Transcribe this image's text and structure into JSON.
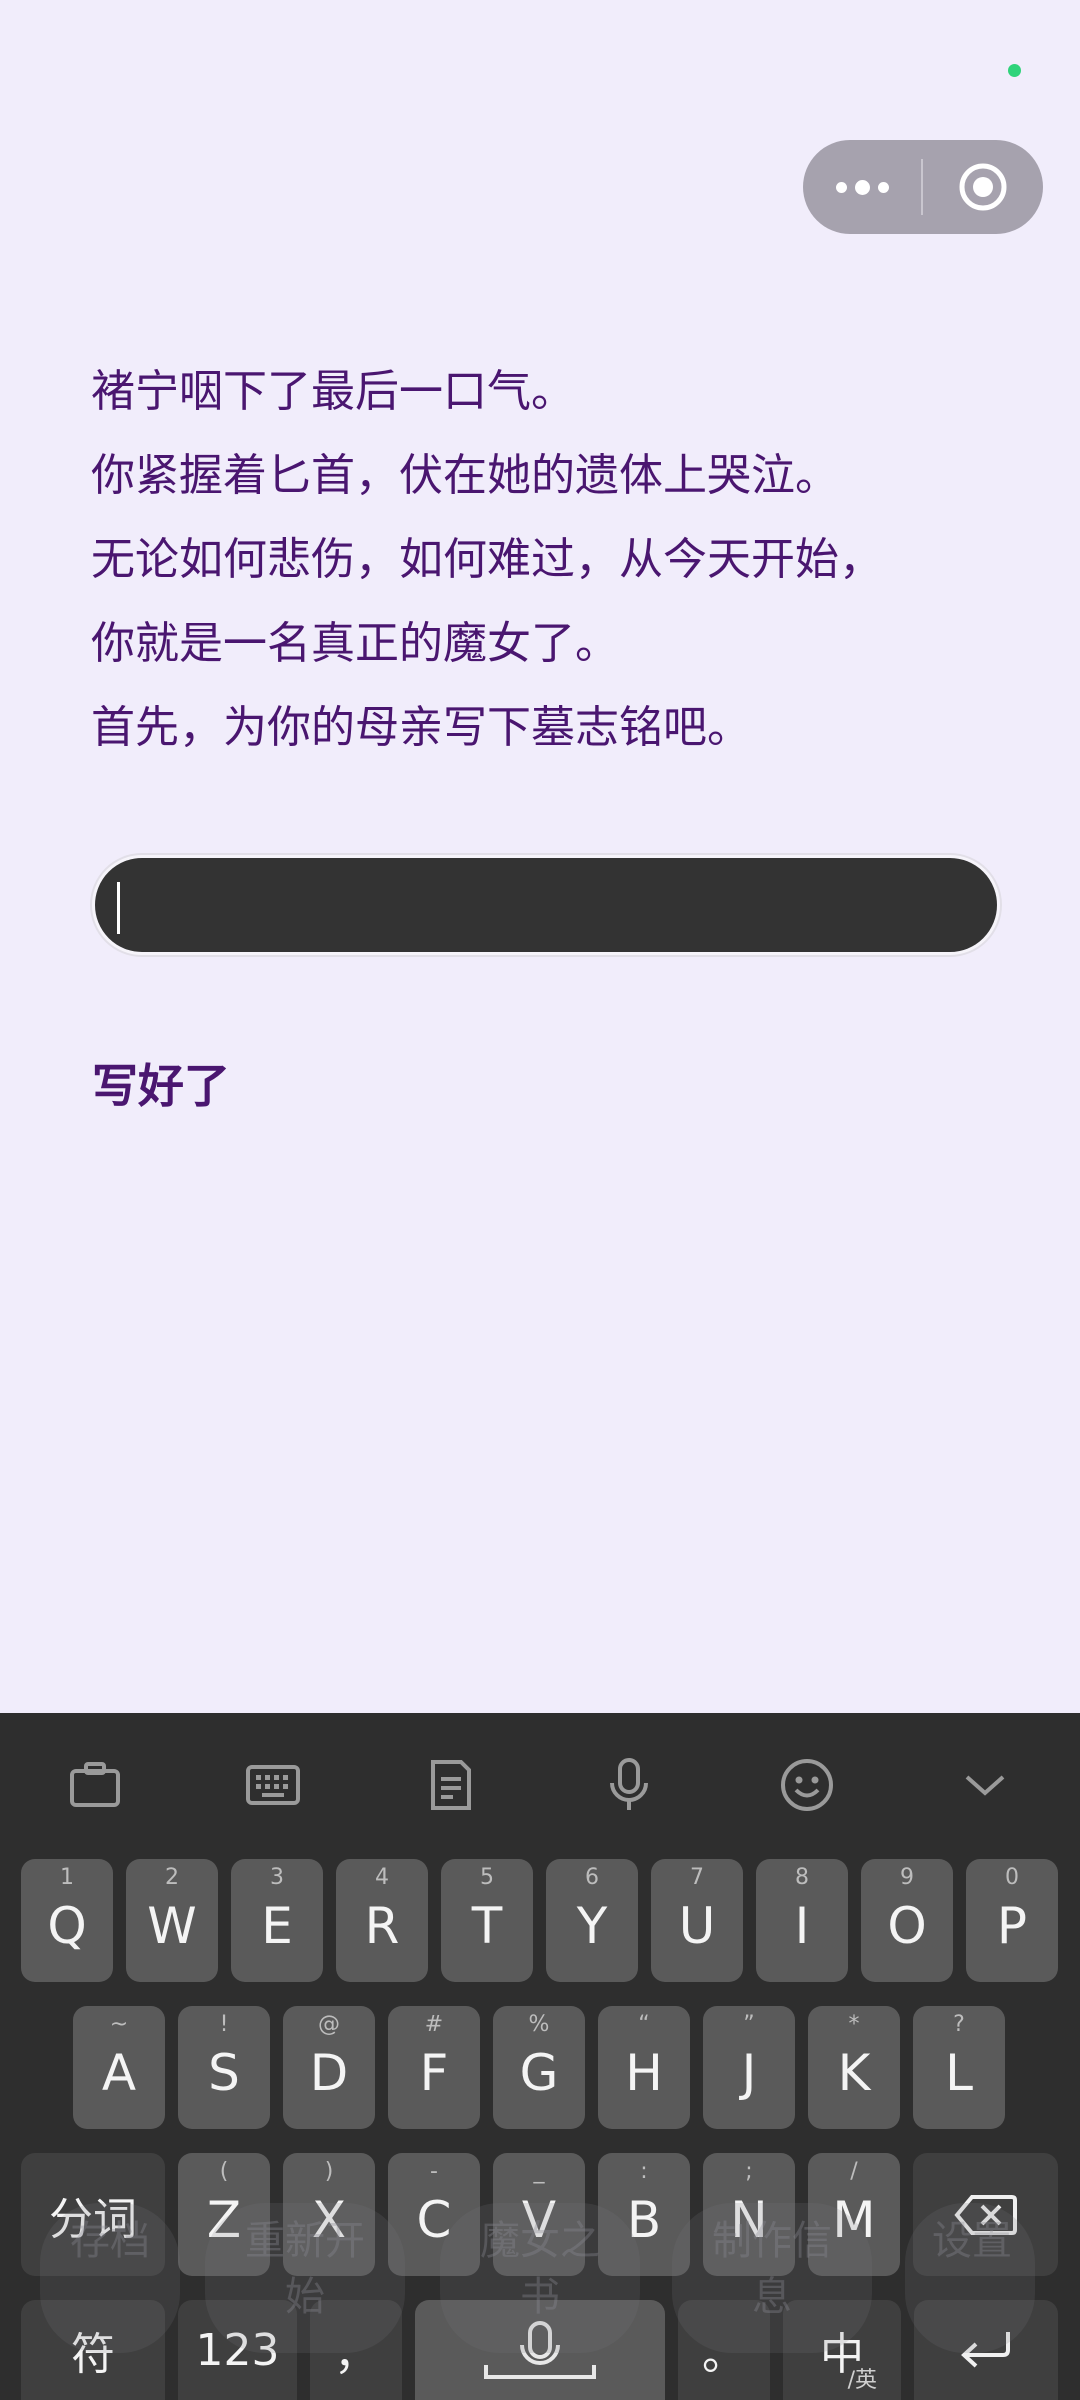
{
  "capsule": {
    "more_icon": "more-dots-icon",
    "close_icon": "record-target-icon"
  },
  "story": {
    "lines": [
      "褚宁咽下了最后一口气。",
      "你紧握着匕首，伏在她的遗体上哭泣。",
      "无论如何悲伤，如何难过，从今天开始，",
      "你就是一名真正的魔女了。",
      "首先，为你的母亲写下墓志铭吧。"
    ]
  },
  "epitaph_input": {
    "value": "",
    "placeholder": ""
  },
  "done_button": {
    "label": "写好了"
  },
  "background_nav": {
    "items": [
      "存档",
      "重新开始",
      "魔女之书",
      "制作信息",
      "设置"
    ]
  },
  "keyboard": {
    "toolbar_icons": [
      "clipboard-icon",
      "keyboard-layout-icon",
      "document-icon",
      "microphone-icon",
      "emoji-icon",
      "chevron-down-icon"
    ],
    "row1": [
      {
        "key": "Q",
        "sub": "1"
      },
      {
        "key": "W",
        "sub": "2"
      },
      {
        "key": "E",
        "sub": "3"
      },
      {
        "key": "R",
        "sub": "4"
      },
      {
        "key": "T",
        "sub": "5"
      },
      {
        "key": "Y",
        "sub": "6"
      },
      {
        "key": "U",
        "sub": "7"
      },
      {
        "key": "I",
        "sub": "8"
      },
      {
        "key": "O",
        "sub": "9"
      },
      {
        "key": "P",
        "sub": "0"
      }
    ],
    "row2": [
      {
        "key": "A",
        "sub": "~"
      },
      {
        "key": "S",
        "sub": "!"
      },
      {
        "key": "D",
        "sub": "@"
      },
      {
        "key": "F",
        "sub": "#"
      },
      {
        "key": "G",
        "sub": "%"
      },
      {
        "key": "H",
        "sub": "“"
      },
      {
        "key": "J",
        "sub": "”"
      },
      {
        "key": "K",
        "sub": "*"
      },
      {
        "key": "L",
        "sub": "?"
      }
    ],
    "row3": [
      {
        "key": "Z",
        "sub": "("
      },
      {
        "key": "X",
        "sub": ")"
      },
      {
        "key": "C",
        "sub": "-"
      },
      {
        "key": "V",
        "sub": "_"
      },
      {
        "key": "B",
        "sub": ":"
      },
      {
        "key": "N",
        "sub": ";"
      },
      {
        "key": "M",
        "sub": "/"
      }
    ],
    "segment_key": "分词",
    "symbols_key": "符",
    "numbers_key": "123",
    "comma_key": "，",
    "period_key": "。",
    "lang_key": "中",
    "lang_key_alt": "/英"
  }
}
